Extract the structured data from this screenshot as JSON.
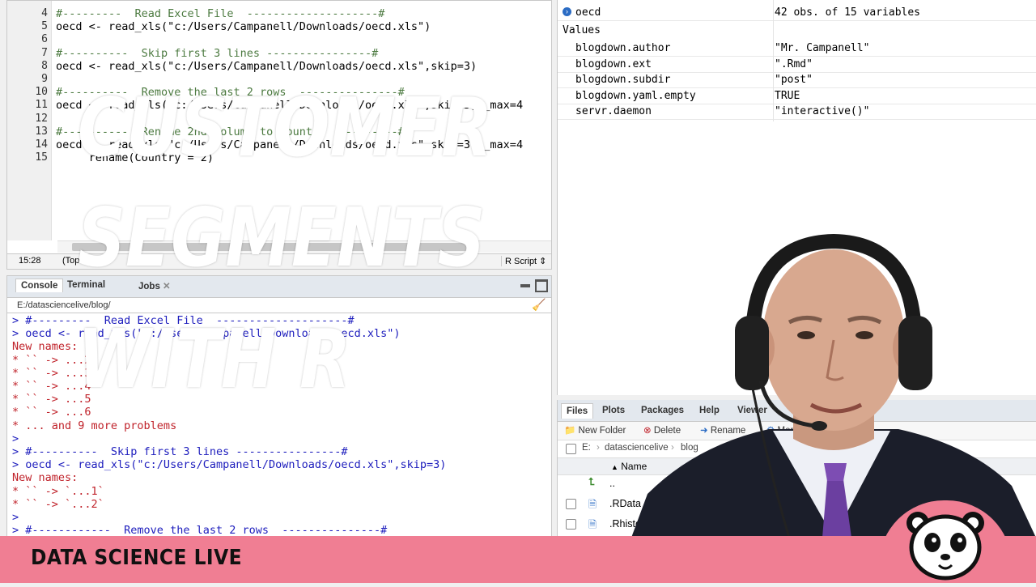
{
  "editor": {
    "lines": [
      {
        "n": "4",
        "code": "#---------  Read Excel File  --------------------#",
        "kind": "comment"
      },
      {
        "n": "5",
        "code": "oecd <- read_xls(\"c:/Users/Campanell/Downloads/oecd.xls\")",
        "kind": "code"
      },
      {
        "n": "6",
        "code": "",
        "kind": "code"
      },
      {
        "n": "7",
        "code": "#----------  Skip first 3 lines ----------------#",
        "kind": "comment"
      },
      {
        "n": "8",
        "code": "oecd <- read_xls(\"c:/Users/Campanell/Downloads/oecd.xls\",skip=3)",
        "kind": "code"
      },
      {
        "n": "9",
        "code": "",
        "kind": "code"
      },
      {
        "n": "10",
        "code": "#----------  Remove the last 2 rows  ---------------#",
        "kind": "comment"
      },
      {
        "n": "11",
        "code": "oecd <- read_xls(\"c:/Users/Campanell/Downloads/oecd.xls\",skip=3,n_max=4",
        "kind": "code"
      },
      {
        "n": "12",
        "code": "",
        "kind": "code"
      },
      {
        "n": "13",
        "code": "#----------  Rename 2nd column to country  ---------#",
        "kind": "comment"
      },
      {
        "n": "14",
        "code": "oecd <- read_xls(\"c:/Users/Campanell/Downloads/oecd.xls\",skip=3,n_max=4",
        "kind": "code"
      },
      {
        "n": "15",
        "code": "     rename(Country = 2)",
        "kind": "code"
      }
    ],
    "status_pos": "15:28",
    "status_scope": "(Top Level)",
    "status_type": "R Script"
  },
  "console": {
    "tabs": [
      "Console",
      "Terminal",
      "Jobs"
    ],
    "path": "E:/datasciencelive/blog/",
    "lines": [
      {
        "text": "> #---------  Read Excel File  --------------------#",
        "color": "blue"
      },
      {
        "text": "> oecd <- read_xls(\"c:/Users/Campanell/Downloads/oecd.xls\")",
        "color": "blue"
      },
      {
        "text": "New names:",
        "color": "red"
      },
      {
        "text": "* `` -> ...2",
        "color": "red"
      },
      {
        "text": "* `` -> ...3",
        "color": "red"
      },
      {
        "text": "* `` -> ...4",
        "color": "red"
      },
      {
        "text": "* `` -> ...5",
        "color": "red"
      },
      {
        "text": "* `` -> ...6",
        "color": "red"
      },
      {
        "text": "* ... and 9 more problems",
        "color": "red"
      },
      {
        "text": ">",
        "color": "blue"
      },
      {
        "text": "> #----------  Skip first 3 lines ----------------#",
        "color": "blue"
      },
      {
        "text": "> oecd <- read_xls(\"c:/Users/Campanell/Downloads/oecd.xls\",skip=3)",
        "color": "blue"
      },
      {
        "text": "New names:",
        "color": "red"
      },
      {
        "text": "* `` -> `...1`",
        "color": "red"
      },
      {
        "text": "* `` -> `...2`",
        "color": "red"
      },
      {
        "text": ">",
        "color": "blue"
      },
      {
        "text": "> #------------  Remove the last 2 rows  ---------------#",
        "color": "blue"
      }
    ]
  },
  "environment": {
    "data_name": "oecd",
    "data_value": "42 obs. of 15 variables",
    "values_header": "Values",
    "values": [
      {
        "name": "blogdown.author",
        "value": "\"Mr. Campanell\""
      },
      {
        "name": "blogdown.ext",
        "value": "\".Rmd\""
      },
      {
        "name": "blogdown.subdir",
        "value": "\"post\""
      },
      {
        "name": "blogdown.yaml.empty",
        "value": "TRUE"
      },
      {
        "name": "servr.daemon",
        "value": "\"interactive()\""
      }
    ]
  },
  "files": {
    "tabs": [
      "Files",
      "Plots",
      "Packages",
      "Help",
      "Viewer"
    ],
    "toolbar": {
      "new_folder": "New Folder",
      "delete": "Delete",
      "rename": "Rename",
      "more": "More"
    },
    "breadcrumb": [
      "E:",
      "datasciencelive",
      "blog"
    ],
    "name_header": "Name",
    "rows": [
      "..",
      ".RData",
      ".Rhistory"
    ]
  },
  "overlay": {
    "line1": "CUSTOMER",
    "line2": "SEGMENTS",
    "line3": "WITH R"
  },
  "footer": {
    "brand": "DATA SCIENCE LIVE"
  },
  "colors": {
    "footer": "#f07e93",
    "comment": "#4c7a40",
    "console_blue": "#1d1dbd",
    "console_red": "#c0222a"
  }
}
